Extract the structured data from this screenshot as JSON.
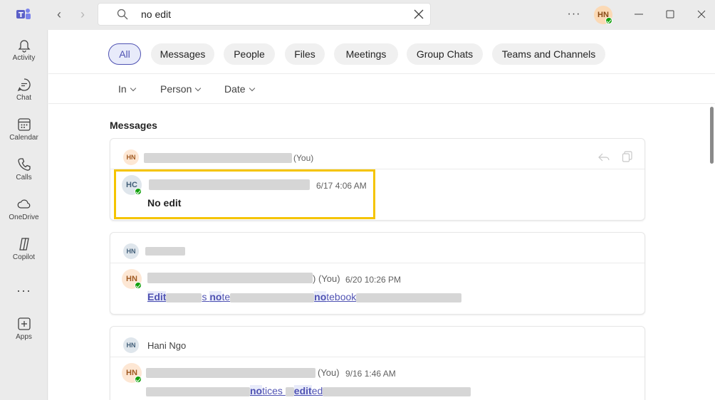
{
  "search": {
    "query": "no edit"
  },
  "user": {
    "initials": "HN"
  },
  "rail": {
    "items": [
      {
        "label": "Activity",
        "icon": "bell-icon"
      },
      {
        "label": "Chat",
        "icon": "chat-icon"
      },
      {
        "label": "Calendar",
        "icon": "calendar-icon"
      },
      {
        "label": "Calls",
        "icon": "phone-icon"
      },
      {
        "label": "OneDrive",
        "icon": "cloud-icon"
      },
      {
        "label": "Copilot",
        "icon": "copilot-icon"
      },
      {
        "label": "Apps",
        "icon": "add-apps-icon"
      }
    ],
    "more": "···"
  },
  "tabs": [
    {
      "label": "All",
      "active": true
    },
    {
      "label": "Messages"
    },
    {
      "label": "People"
    },
    {
      "label": "Files"
    },
    {
      "label": "Meetings"
    },
    {
      "label": "Group Chats"
    },
    {
      "label": "Teams and Channels"
    }
  ],
  "filters": [
    {
      "label": "In"
    },
    {
      "label": "Person"
    },
    {
      "label": "Date"
    }
  ],
  "section": {
    "title": "Messages"
  },
  "results": [
    {
      "head_initials": "HN",
      "head_suffix": "(You)",
      "sender_initials": "HC",
      "time": "6/17 4:06 AM",
      "body": "No edit"
    },
    {
      "head_initials": "HN",
      "sender_initials": "HN",
      "sender_suffix": ") (You)",
      "time": "6/20 10:26 PM",
      "body_parts": [
        "Edit",
        "s ",
        "no",
        "te",
        "no",
        "tebook"
      ]
    },
    {
      "head_initials": "HN",
      "head_name": "Hani Ngo",
      "sender_initials": "HN",
      "sender_suffix": "(You)",
      "time": "9/16 1:46 AM",
      "body_parts": [
        "no",
        "tices ",
        "edit",
        "ed"
      ]
    }
  ],
  "colors": {
    "accent": "#4f52b2",
    "highlight_box": "#f5c400",
    "presence": "#13a10e"
  }
}
